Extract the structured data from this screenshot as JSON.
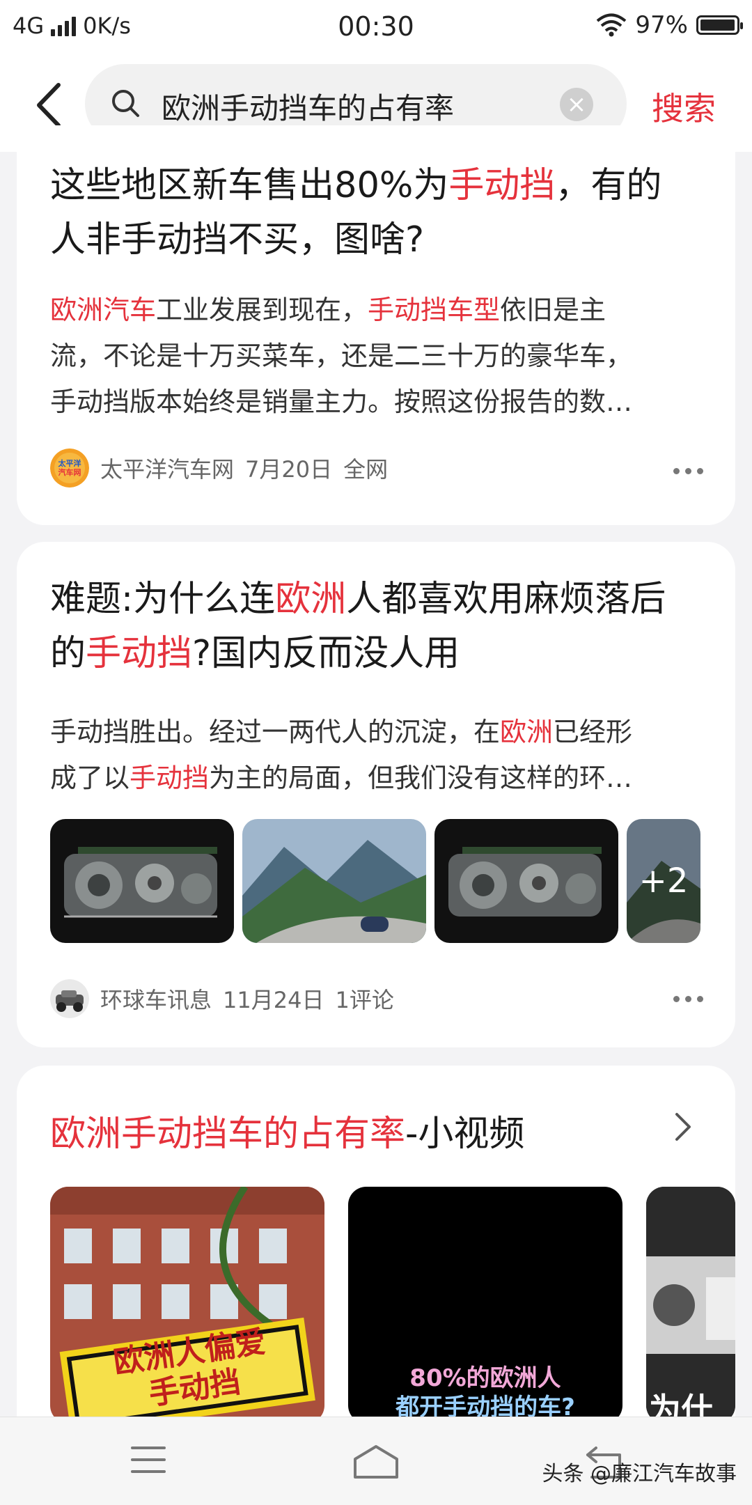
{
  "status_bar": {
    "network": "4G",
    "speed": "0K/s",
    "time": "00:30",
    "battery": "97%",
    "battery_level": 0.97
  },
  "search": {
    "query": "欧洲手动挡车的占有率",
    "button": "搜索"
  },
  "results": [
    {
      "title_parts": [
        "这些地区新车售出80%为",
        "手动挡",
        "，有的"
      ],
      "title_line2": "人非手动挡不买，图啥?",
      "snippet_line1_parts": [
        "欧洲汽车",
        "工业发展到现在，",
        "手动挡车型",
        "依旧是主"
      ],
      "snippet_line2": "流，不论是十万买菜车，还是二三十万的豪华车，",
      "snippet_line3": "手动挡版本始终是销量主力。按照这份报告的数…",
      "source": "太平洋汽车网",
      "source_logo_text": "太平洋汽车网",
      "date": "7月20日",
      "extra": "全网"
    },
    {
      "title_parts": [
        "难题:为什么连",
        "欧洲",
        "人都喜欢用麻烦落后"
      ],
      "title_line2_parts": [
        "的",
        "手动挡",
        "?国内反而没人用"
      ],
      "snippet_line1_parts": [
        "手动挡胜出。经过一两代人的沉淀，在",
        "欧洲",
        "已经形"
      ],
      "snippet_line2_parts": [
        "成了以",
        "手动挡",
        "为主的局面，但我们没有这样的环…"
      ],
      "image_more": "+2",
      "source": "环球车讯息",
      "date": "11月24日",
      "extra": "1评论"
    }
  ],
  "video_section": {
    "title_highlight": "欧洲手动挡车的占有率",
    "title_suffix": "-小视频",
    "videos": [
      {
        "caption_line1": "欧洲人偏爱",
        "caption_line2": "手动挡"
      },
      {
        "caption_line1": "80%的欧洲人",
        "caption_line2": "都开手动挡的车?"
      },
      {
        "caption_line1": "为什"
      }
    ]
  },
  "watermark": "头条 @廉江汽车故事"
}
